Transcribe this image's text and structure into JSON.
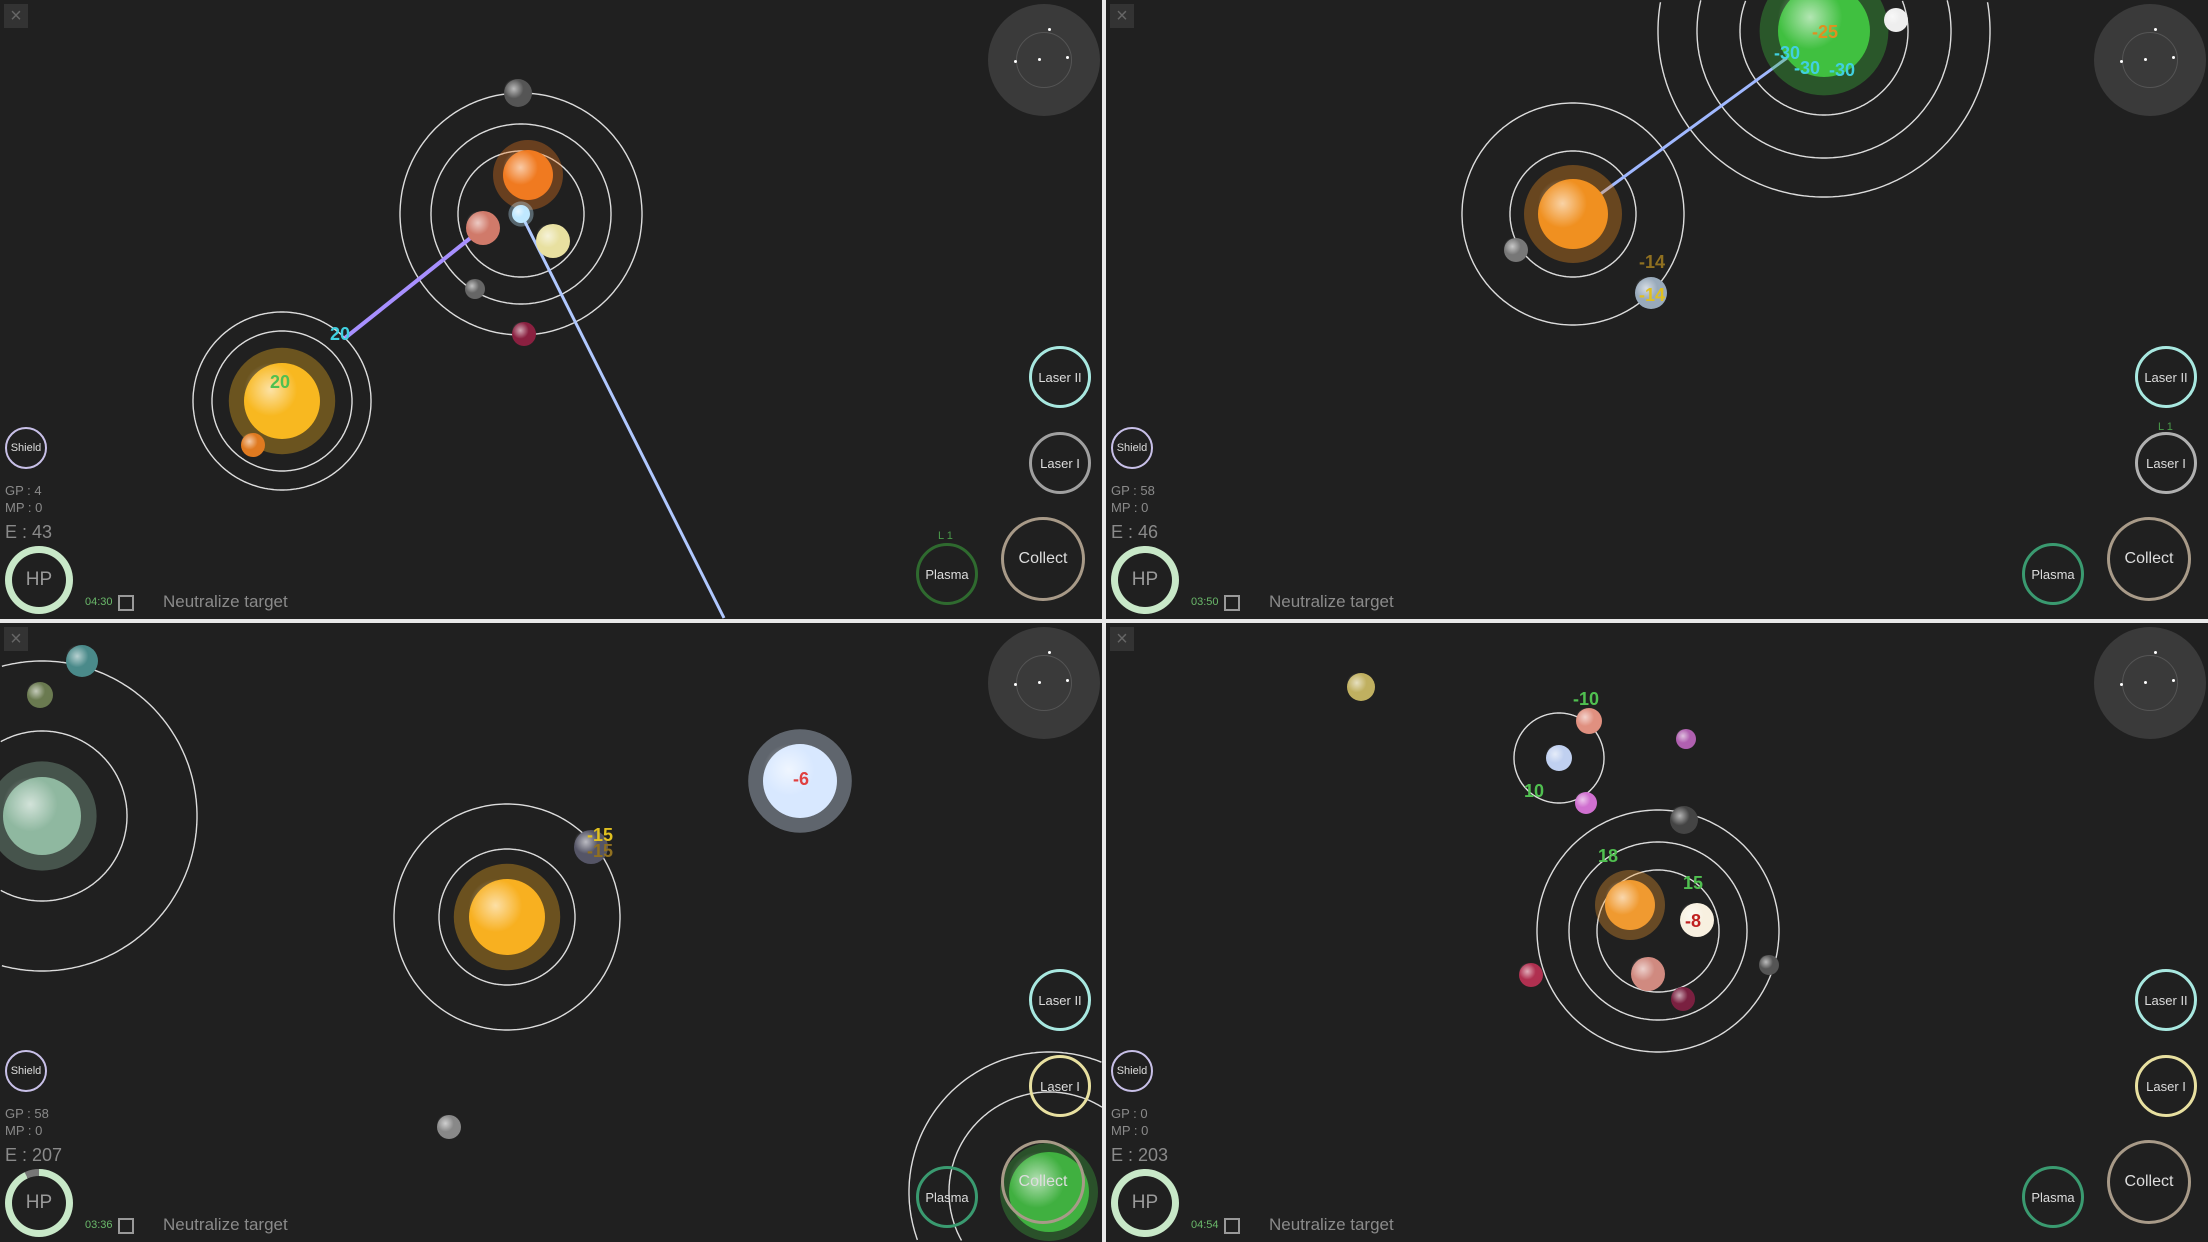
{
  "panels": [
    {
      "gp": "GP : 4",
      "mp": "MP : 0",
      "e": "E : 43",
      "timer": "04:30",
      "objective": "Neutralize target",
      "shield": "Shield",
      "hp": "HP",
      "laser2": "Laser II",
      "laser1": "Laser I",
      "collect": "Collect",
      "plasma": "Plasma",
      "plasma_level": "L 1",
      "laser1_level": "",
      "hp_fill": 1.0,
      "damage": [
        {
          "t": "20",
          "c": "#40d0e0"
        },
        {
          "t": "20",
          "c": "#50c050"
        }
      ],
      "colors": {
        "laser2": "#a8e8e0",
        "laser1": "#a0a0a0",
        "collect": "#a89a88",
        "plasma": "#2f6a2f"
      }
    },
    {
      "gp": "GP : 58",
      "mp": "MP : 0",
      "e": "E : 46",
      "timer": "03:50",
      "objective": "Neutralize target",
      "shield": "Shield",
      "hp": "HP",
      "laser2": "Laser II",
      "laser1": "Laser I",
      "collect": "Collect",
      "plasma": "Plasma",
      "plasma_level": "",
      "laser1_level": "L 1",
      "hp_fill": 1.0,
      "damage": [
        {
          "t": "-25",
          "c": "#e09020"
        },
        {
          "t": "-30",
          "c": "#40d0e0"
        },
        {
          "t": "-30",
          "c": "#40d0e0"
        },
        {
          "t": "-14",
          "c": "#e0c020"
        },
        {
          "t": "-14",
          "c": "#907020"
        },
        {
          "t": "-30",
          "c": "#40d0e0"
        }
      ],
      "colors": {
        "laser2": "#a8e8e0",
        "laser1": "#b0b0b0",
        "collect": "#a89a88",
        "plasma": "#3a9a70"
      }
    },
    {
      "gp": "GP : 58",
      "mp": "MP : 0",
      "e": "E : 207",
      "timer": "03:36",
      "objective": "Neutralize target",
      "shield": "Shield",
      "hp": "HP",
      "laser2": "Laser II",
      "laser1": "Laser I",
      "collect": "Collect",
      "plasma": "Plasma",
      "plasma_level": "",
      "laser1_level": "",
      "hp_fill": 0.93,
      "damage": [
        {
          "t": "-15",
          "c": "#e0c020"
        },
        {
          "t": "-15",
          "c": "#907020"
        },
        {
          "t": "-6",
          "c": "#e04040"
        }
      ],
      "colors": {
        "laser2": "#a8e8e0",
        "laser1": "#e8e0a0",
        "collect": "#a89a88",
        "plasma": "#3a9a70"
      }
    },
    {
      "gp": "GP : 0",
      "mp": "MP : 0",
      "e": "E : 203",
      "timer": "04:54",
      "objective": "Neutralize target",
      "shield": "Shield",
      "hp": "HP",
      "laser2": "Laser II",
      "laser1": "Laser I",
      "collect": "Collect",
      "plasma": "Plasma",
      "plasma_level": "",
      "laser1_level": "",
      "hp_fill": 1.0,
      "damage": [
        {
          "t": "-10",
          "c": "#50c050"
        },
        {
          "t": "18",
          "c": "#50c050"
        },
        {
          "t": "-8",
          "c": "#c02020"
        },
        {
          "t": "15",
          "c": "#50c050"
        },
        {
          "t": "10",
          "c": "#50c050"
        }
      ],
      "colors": {
        "laser2": "#a8e8e0",
        "laser1": "#e8e0a0",
        "collect": "#a89a88",
        "plasma": "#3a9a70"
      }
    }
  ]
}
